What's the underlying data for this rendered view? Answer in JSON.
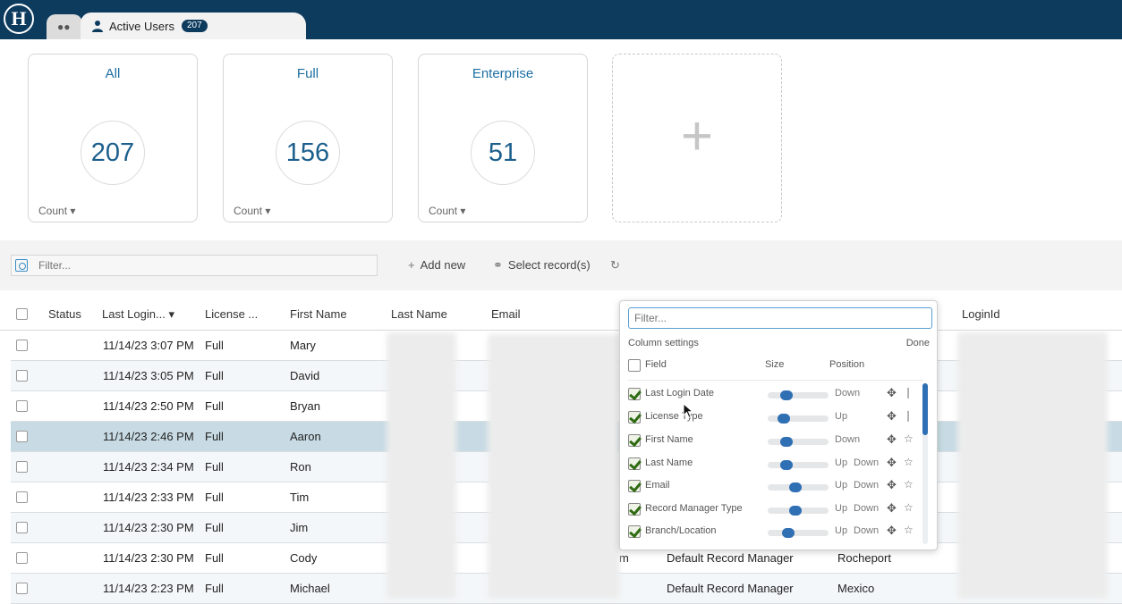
{
  "colors": {
    "brand": "#0d3b5e",
    "accent": "#1c6fa3",
    "selected_row": "#c8dbe4",
    "slider": "#2f6fb3",
    "check": "#2f6b12"
  },
  "header": {
    "logo_text": "H",
    "home_tab_icon": "team-icon",
    "active_tab": {
      "icon": "user-icon",
      "label": "Active Users",
      "badge": "207"
    }
  },
  "tiles": [
    {
      "title": "All",
      "value": "207",
      "footer": "Count"
    },
    {
      "title": "Full",
      "value": "156",
      "footer": "Count"
    },
    {
      "title": "Enterprise",
      "value": "51",
      "footer": "Count"
    }
  ],
  "add_tile_symbol": "+",
  "toolbar": {
    "filter_placeholder": "Filter...",
    "add_new": "Add new",
    "select_records": "Select record(s)"
  },
  "table": {
    "columns": [
      "Status",
      "Last Login...",
      "License ...",
      "First Name",
      "Last Name",
      "Email",
      "LoginId"
    ],
    "rows": [
      {
        "last_login": "11/14/23 3:07 PM",
        "license": "Full",
        "first_name": "Mary"
      },
      {
        "last_login": "11/14/23 3:05 PM",
        "license": "Full",
        "first_name": "David"
      },
      {
        "last_login": "11/14/23 2:50 PM",
        "license": "Full",
        "first_name": "Bryan"
      },
      {
        "last_login": "11/14/23 2:46 PM",
        "license": "Full",
        "first_name": "Aaron"
      },
      {
        "last_login": "11/14/23 2:34 PM",
        "license": "Full",
        "first_name": "Ron"
      },
      {
        "last_login": "11/14/23 2:33 PM",
        "license": "Full",
        "first_name": "Tim"
      },
      {
        "last_login": "11/14/23 2:30 PM",
        "license": "Full",
        "first_name": "Jim"
      },
      {
        "last_login": "11/14/23 2:30 PM",
        "license": "Full",
        "first_name": "Cody",
        "email_tail": "m",
        "record_manager": "Default Record Manager",
        "location": "Rocheport"
      },
      {
        "last_login": "11/14/23 2:23 PM",
        "license": "Full",
        "first_name": "Michael",
        "record_manager": "Default Record Manager",
        "location": "Mexico"
      }
    ],
    "selected_row_index": 3
  },
  "column_settings": {
    "filter_placeholder": "Filter...",
    "title": "Column settings",
    "done": "Done",
    "headers": {
      "field": "Field",
      "size": "Size",
      "position": "Position"
    },
    "fields": [
      {
        "name": "Last Login Date",
        "size": 0.25,
        "up": "",
        "down": "Down",
        "pin": "pinned-icon"
      },
      {
        "name": "License Type",
        "size": 0.2,
        "up": "Up",
        "down": "",
        "pin": "pinned-icon"
      },
      {
        "name": "First Name",
        "size": 0.25,
        "up": "",
        "down": "Down",
        "pin": "pin-icon"
      },
      {
        "name": "Last Name",
        "size": 0.25,
        "up": "Up",
        "down": "Down",
        "pin": "pin-icon"
      },
      {
        "name": "Email",
        "size": 0.45,
        "up": "Up",
        "down": "Down",
        "pin": "pin-icon"
      },
      {
        "name": "Record Manager Type",
        "size": 0.45,
        "up": "Up",
        "down": "Down",
        "pin": "pin-icon"
      },
      {
        "name": "Branch/Location",
        "size": 0.3,
        "up": "Up",
        "down": "Down",
        "pin": "pin-icon"
      }
    ]
  }
}
